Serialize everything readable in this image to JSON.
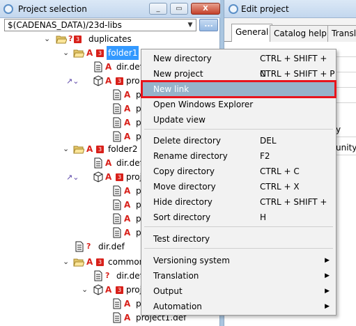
{
  "left_window": {
    "title": "Project selection",
    "controls": [
      "_",
      "▭",
      "X"
    ],
    "path": "$(CADENAS_DATA)/23d-libs",
    "browse_label": "..."
  },
  "tree": {
    "duplicates": "duplicates",
    "folder1": "folder1",
    "dir_def": "dir.def",
    "proj_prefix": "pro",
    "p": "p",
    "folder2": "folder2",
    "dir_def2": "dir.def",
    "proj2": "proj",
    "dir_def_root": "dir.def",
    "common": "common",
    "dir_def3": "dir.def",
    "proj3": "proj",
    "p3": "p",
    "project1": "project1.def"
  },
  "right_window": {
    "title": "Edit project",
    "tabs": [
      "General",
      "Catalog help",
      "Transla"
    ],
    "rows": [
      "",
      "",
      "",
      "",
      "y",
      "unity"
    ]
  },
  "context_menu": {
    "items": [
      {
        "label": "New directory",
        "shortcut": "CTRL + SHIFT + N"
      },
      {
        "label": "New project",
        "shortcut": "CTRL + SHIFT + P"
      },
      {
        "label": "New link",
        "shortcut": ""
      },
      {
        "label": "Open Windows Explorer",
        "shortcut": ""
      },
      {
        "label": "Update view",
        "shortcut": ""
      },
      {
        "label": "Delete directory",
        "shortcut": "DEL"
      },
      {
        "label": "Rename directory",
        "shortcut": "F2"
      },
      {
        "label": "Copy directory",
        "shortcut": "CTRL + C"
      },
      {
        "label": "Move directory",
        "shortcut": "CTRL + X"
      },
      {
        "label": "Hide directory",
        "shortcut": "CTRL + SHIFT + H"
      },
      {
        "label": "Sort directory",
        "shortcut": ""
      },
      {
        "label": "Test directory",
        "shortcut": ""
      },
      {
        "label": "Versioning system",
        "shortcut": ""
      },
      {
        "label": "Translation",
        "shortcut": ""
      },
      {
        "label": "Output",
        "shortcut": ""
      },
      {
        "label": "Automation",
        "shortcut": ""
      }
    ],
    "submenu_arrow": "▶",
    "highlight_color": "#e8141c"
  }
}
